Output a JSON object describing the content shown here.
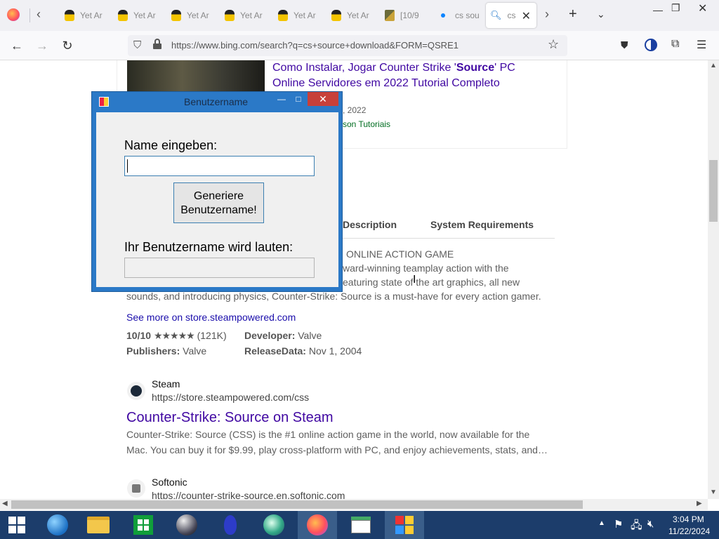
{
  "browser": {
    "tabs": [
      {
        "label": "Yet Ar"
      },
      {
        "label": "Yet Ar"
      },
      {
        "label": "Yet Ar"
      },
      {
        "label": "Yet Ar"
      },
      {
        "label": "Yet Ar"
      },
      {
        "label": "Yet Ar"
      },
      {
        "label": "[10/9"
      },
      {
        "label": "cs sou"
      },
      {
        "label": "cs"
      }
    ],
    "url": "https://www.bing.com/search?q=cs+source+download&FORM=QSRE1"
  },
  "results": {
    "video": {
      "title_part1": "Como Instalar, Jogar Counter Strike '",
      "title_bold": "Source",
      "title_part2": "' PC",
      "title_line2": "Online Servidores em 2022 Tutorial Completo",
      "date_partial": ", 2022",
      "channel_partial": "son Tutoriais"
    },
    "tabs": {
      "description": "Description",
      "requirements": "System Requirements"
    },
    "desc": {
      "line1": "ONLINE ACTION GAME",
      "line2": "ward-winning teamplay action with the",
      "line3_a": "eaturing state of",
      "line3_b": " the art graphics, all new",
      "line4": "sounds, and introducing physics, Counter-Strike: Source is a must-have for every action gamer."
    },
    "see_more": "See more on store.steampowered.com",
    "rating": "10/10",
    "stars": "★★★★★",
    "rating_count": "(121K)",
    "developer_label": "Developer:",
    "developer": "Valve",
    "publishers_label": "Publishers:",
    "publishers": "Valve",
    "release_label": "ReleaseData:",
    "release": "Nov 1, 2004",
    "steam": {
      "site": "Steam",
      "url": "https://store.steampowered.com/css",
      "title": "Counter-Strike: Source on Steam",
      "snippet1": "Counter-Strike: Source (CSS) is the #1 online action game in the world, now available for the",
      "snippet2": "Mac. You can buy it for $9.99, play cross-platform with PC, and enjoy achievements, stats, and…"
    },
    "softonic": {
      "site": "Softonic",
      "url": "https://counter-strike-source.en.softonic.com"
    }
  },
  "dialog": {
    "title": "Benutzername",
    "name_label": "Name eingeben:",
    "name_value": "",
    "button_line1": "Generiere",
    "button_line2": "Benutzername!",
    "result_label": "Ihr Benutzername wird lauten:",
    "result_value": ""
  },
  "taskbar": {
    "time": "3:04 PM",
    "date": "11/22/2024"
  },
  "colors": {
    "link": "#4007a2",
    "dialog_frame": "#2b79c7",
    "close_button": "#c7403a",
    "taskbar": "#1c3d6b"
  }
}
